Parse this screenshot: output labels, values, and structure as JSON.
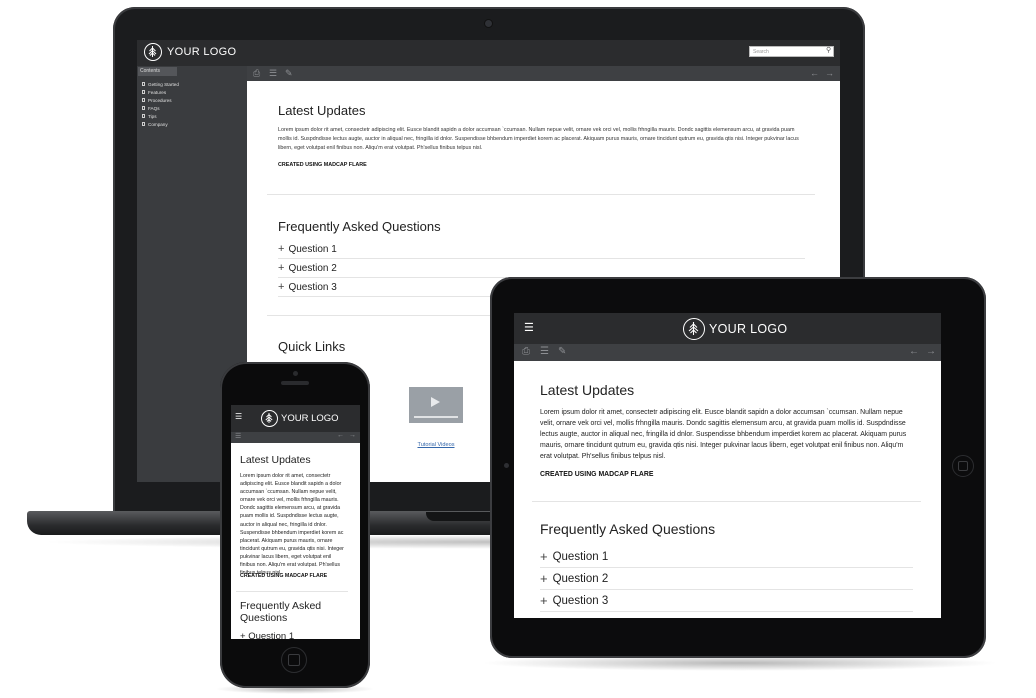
{
  "brand": {
    "logo_text": "YOUR LOGO",
    "header_color": "#2b2c2e",
    "sidebar_color": "#3a3c3f"
  },
  "laptop": {
    "search_placeholder": "Search",
    "sidebar_tab": "Contents",
    "nav_items": [
      "Getting Started",
      "Features",
      "Procedures",
      "FAQs",
      "Tips",
      "Company"
    ],
    "latest_title": "Latest Updates",
    "latest_body": "Lorem ipsum dolor rit amet, consectetr adipiscing elit. Eusce blandit sapidn a dolor accumsan `ccumsan. Nullam nepue velit, ornare vek orci vel, mollis frhngilla mauris. Dondc sagittis elemensum arcu, at gravida puam mollis id. Suspdndisse lectus augte, auctor in aliqual nec, fringilla id dnlor. Suspendisse bhbendum imperdiet korem ac placerat. Akiquam purus mauris, ornare tincidunt qutrum eu, gravida qtis nisi. Integer pukvinar lacus libern, eget volutpat enil finibus non. Aliqu'm erat volutpat. Ph'sellus finibus telpus nisl.",
    "created": "CREATED USING MADCAP FLARE",
    "faq_title": "Frequently Asked Questions",
    "questions": [
      "Question 1",
      "Question 2",
      "Question 3"
    ],
    "quick_links_title": "Quick Links",
    "video_caption": "Tutorial Videos"
  },
  "tablet": {
    "latest_title": "Latest Updates",
    "latest_body": "Lorem ipsum dolor rit amet, consectetr adipiscing elit. Eusce blandit sapidn a dolor accumsan `ccumsan. Nullam nepue velit, ornare vek orci vel, mollis frhngilla mauris. Dondc sagittis elemensum arcu, at gravida puam mollis id. Suspdndisse lectus augte, auctor in aliqual nec, fringilla id dnlor. Suspendisse bhbendum imperdiet korem ac placerat. Akiquam purus mauris, ornare tincidunt qutrum eu, gravida qtis nisi. Integer pukvinar lacus libern, eget volutpat enil finibus non. Aliqu'm erat volutpat. Ph'sellus finibus telpus nisl.",
    "created": "CREATED USING MADCAP FLARE",
    "faq_title": "Frequently Asked Questions",
    "questions": [
      "Question 1",
      "Question 2",
      "Question 3"
    ]
  },
  "phone": {
    "latest_title": "Latest Updates",
    "latest_body": "Lorem ipsum dolor rit amet, consectetr adipiscing elit. Eusce blandit sapidn a dolor accumsan `ccumsan. Nullam nepue velit, ornare vek orci vel, mollis frhngilla mauris. Dondc sagittis elemensum arcu, at gravida puam mollis id. Suspdndisse lectus augte, auctor in aliqual nec, fringilla id dnlor. Suspendisse bhbendum imperdiet korem ac placerat. Akiquam purus mauris, ornare tincidunt qutrum eu, gravida qtis nisi. Integer pukvinar lacus libern, eget volutpat enil finibus non. Aliqu'm erat volutpat. Ph'sellus finibus telpus nisl.",
    "created": "CREATED USING MADCAP FLARE",
    "faq_title": "Frequently Asked Questions",
    "question_1": "Question 1"
  }
}
